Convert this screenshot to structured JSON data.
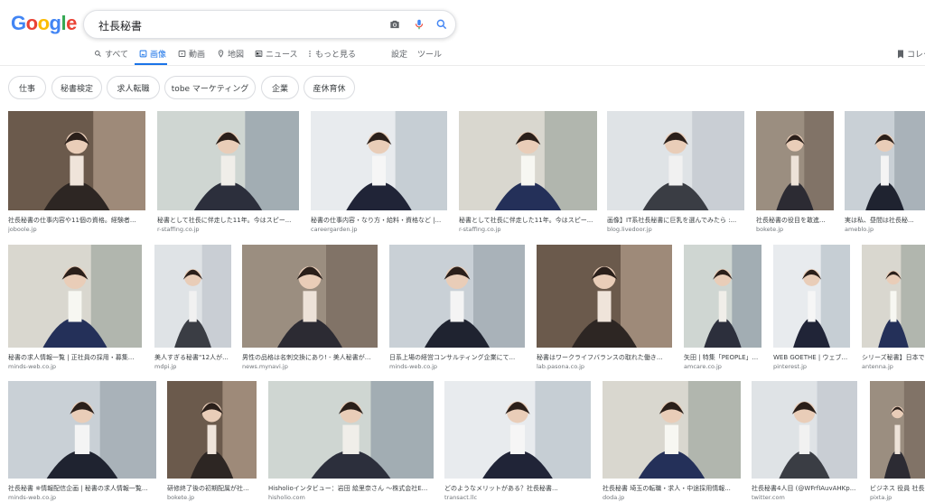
{
  "logo": {
    "letters": [
      "G",
      "o",
      "o",
      "g",
      "l",
      "e"
    ]
  },
  "search": {
    "query": "社長秘書"
  },
  "tabs": {
    "all": "すべて",
    "images": "画像",
    "videos": "動画",
    "maps": "地図",
    "news": "ニュース",
    "more": "もっと見る",
    "settings": "設定",
    "tools": "ツール"
  },
  "collections_label": "コレク",
  "chips": [
    "仕事",
    "秘書検定",
    "求人転職",
    "tobe マーケティング",
    "企業",
    "産休育休"
  ],
  "rows": [
    [
      {
        "caption": "社長秘書の仕事内容や11個の資格。経験者...",
        "source": "joboole.jp"
      },
      {
        "caption": "秘書として社長に伴走した11年。今はスピー...",
        "source": "r-staffing.co.jp"
      },
      {
        "caption": "秘書の仕事内容・なり方・給料・資格など |...",
        "source": "careergarden.jp"
      },
      {
        "caption": "秘書として社長に伴走した11年。今はスピー...",
        "source": "r-staffing.co.jp"
      },
      {
        "caption": "画像】IT系社長秘書に巨乳を選んでみたら :...",
        "source": "blog.livedoor.jp"
      },
      {
        "caption": "社長秘書の役目を敢進...",
        "source": "bokete.jp"
      },
      {
        "caption": "実は私、昼間は社長秘...",
        "source": "ameblo.jp"
      }
    ],
    [
      {
        "caption": "秘書の求人情報一覧 | 正社員の採用・募集...",
        "source": "minds-web.co.jp"
      },
      {
        "caption": "美人すぎる秘書\"12人が...",
        "source": "mdpi.jp"
      },
      {
        "caption": "男性の品格は名刺交換にあり! - 美人秘書が...",
        "source": "news.mynavi.jp"
      },
      {
        "caption": "日系上場の経営コンサルティング企業にて...",
        "source": "minds-web.co.jp"
      },
      {
        "caption": "秘書はワークライフバランスの取れた働き...",
        "source": "lab.pasona.co.jp"
      },
      {
        "caption": "矢田 | 特集「PEOPLE」...",
        "source": "amcare.co.jp"
      },
      {
        "caption": "WEB GOETHE | ウェブ...",
        "source": "pinterest.jp"
      },
      {
        "caption": "シリーズ秘書】日本で...",
        "source": "antenna.jp"
      }
    ],
    [
      {
        "caption": "社長秘書 ※情報配信企画 | 秘書の求人情報一覧...",
        "source": "minds-web.co.jp"
      },
      {
        "caption": "研修終了後の初期配属が社...",
        "source": "bokete.jp"
      },
      {
        "caption": "Hisholioインタビュー：岩田 絵里奈さん ～株式会社E...",
        "source": "hisholio.com"
      },
      {
        "caption": "どのようなメリットがある？社長秘書...",
        "source": "transact.llc"
      },
      {
        "caption": "社長秘書 埼玉の転職・求人・中途採用情報...",
        "source": "doda.jp"
      },
      {
        "caption": "社長秘書4人目 (@WFrfIAuvAHKp...",
        "source": "twitter.com"
      },
      {
        "caption": "ビジネス 役員 社長",
        "source": "pixta.jp"
      }
    ]
  ],
  "colors": {
    "link_blue": "#1a73e8",
    "google_blue": "#4285f4",
    "google_red": "#ea4335",
    "google_yellow": "#fbbc05",
    "google_green": "#34a853"
  }
}
